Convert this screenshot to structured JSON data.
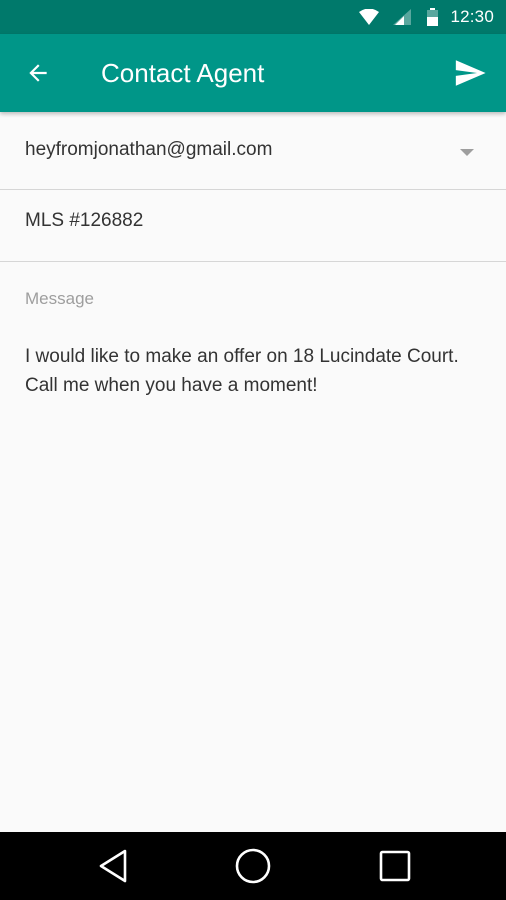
{
  "status_bar": {
    "time": "12:30",
    "icons": [
      "wifi-icon",
      "signal-icon",
      "battery-icon"
    ]
  },
  "app_bar": {
    "title": "Contact Agent",
    "back_icon": "arrow-back-icon",
    "send_icon": "send-icon",
    "color": "#009688",
    "status_color": "#00796b"
  },
  "form": {
    "from_email": "heyfromjonathan@gmail.com",
    "subject": "MLS #126882",
    "message_label": "Message",
    "message_lines": [
      "I would like to make an offer on 18 Lucindate Court.",
      "Call me when you have a moment!"
    ]
  },
  "nav_bar": {
    "icons": [
      "back-triangle-icon",
      "home-circle-icon",
      "recents-square-icon"
    ]
  }
}
